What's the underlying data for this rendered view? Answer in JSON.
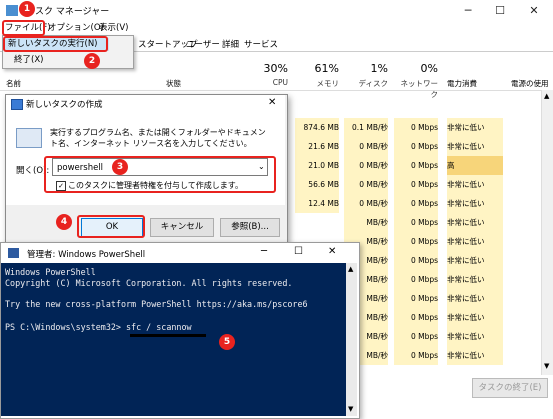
{
  "taskmanager": {
    "title": "タスク マネージャー",
    "menu": [
      "ファイル(F)",
      "オプション(O)",
      "表示(V)"
    ],
    "tabs": [
      "スタートアップ",
      "ユーザー",
      "詳細",
      "サービス"
    ],
    "columns": {
      "name": "名前",
      "status": "状態",
      "cpu": {
        "pct": "30%",
        "label": "CPU"
      },
      "memory": {
        "pct": "61%",
        "label": "メモリ"
      },
      "disk": {
        "pct": "1%",
        "label": "ディスク"
      },
      "network": {
        "pct": "0%",
        "label": "ネットワーク"
      },
      "power": "電力消費",
      "power_trend": "電源の使用"
    },
    "rows": [
      {
        "mem": "874.6 MB",
        "disk": "0.1 MB/秒",
        "net": "0 Mbps",
        "power": "非常に低い"
      },
      {
        "mem": "21.6 MB",
        "disk": "0 MB/秒",
        "net": "0 Mbps",
        "power": "非常に低い"
      },
      {
        "mem": "21.0 MB",
        "disk": "0 MB/秒",
        "net": "0 Mbps",
        "power": "高"
      },
      {
        "mem": "56.6 MB",
        "disk": "0 MB/秒",
        "net": "0 Mbps",
        "power": "非常に低い"
      },
      {
        "mem": "12.4 MB",
        "disk": "0 MB/秒",
        "net": "0 Mbps",
        "power": "非常に低い"
      },
      {
        "mem": "",
        "disk": "MB/秒",
        "net": "0 Mbps",
        "power": "非常に低い"
      },
      {
        "mem": "",
        "disk": "MB/秒",
        "net": "0 Mbps",
        "power": "非常に低い"
      },
      {
        "mem": "",
        "disk": "MB/秒",
        "net": "0 Mbps",
        "power": "非常に低い"
      },
      {
        "mem": "",
        "disk": "MB/秒",
        "net": "0 Mbps",
        "power": "非常に低い"
      },
      {
        "mem": "",
        "disk": "MB/秒",
        "net": "0 Mbps",
        "power": "非常に低い"
      },
      {
        "mem": "",
        "disk": "MB/秒",
        "net": "0 Mbps",
        "power": "非常に低い"
      },
      {
        "mem": "",
        "disk": "MB/秒",
        "net": "0 Mbps",
        "power": "非常に低い"
      },
      {
        "mem": "",
        "disk": "MB/秒",
        "net": "0 Mbps",
        "power": "非常に低い"
      }
    ],
    "end_task": "タスクの終了(E)"
  },
  "context_menu": {
    "new_task": "新しいタスクの実行(N)",
    "exit": "終了(X)"
  },
  "run_dialog": {
    "title": "新しいタスクの作成",
    "description": "実行するプログラム名、または開くフォルダーやドキュメント名、インターネット リソース名を入力してください。",
    "open_label": "開く(O):",
    "input_value": "powershell",
    "checkbox_label": "このタスクに管理者特権を付与して作成します。",
    "ok": "OK",
    "cancel": "キャンセル",
    "browse": "参照(B)..."
  },
  "powershell": {
    "title": "管理者: Windows PowerShell",
    "lines": [
      "Windows PowerShell",
      "Copyright (C) Microsoft Corporation. All rights reserved.",
      "",
      "Try the new cross-platform PowerShell https://aka.ms/pscore6",
      "",
      "PS C:\\Windows\\system32> sfc / scannow"
    ]
  },
  "callouts": [
    "1",
    "2",
    "3",
    "4",
    "5"
  ],
  "colors": {
    "accent": "#e8231f",
    "ps_bg": "#012456",
    "selection": "#cce4f7"
  }
}
